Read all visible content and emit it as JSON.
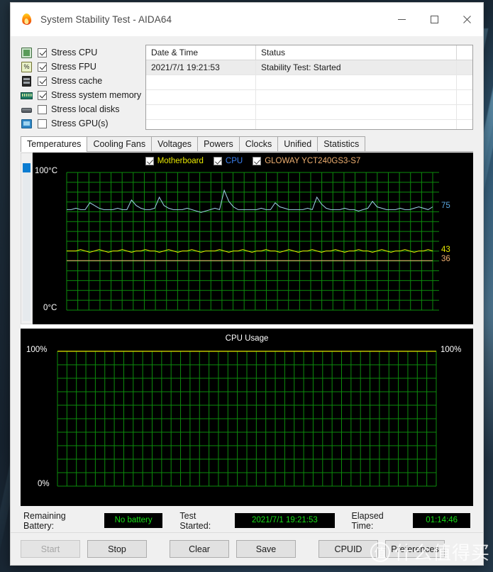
{
  "window": {
    "title": "System Stability Test - AIDA64",
    "icon": "flame-icon",
    "minimize": "─",
    "maximize": "□",
    "close": "✕"
  },
  "stress_options": [
    {
      "icon": "cpu-chip-icon",
      "label": "Stress CPU",
      "checked": true
    },
    {
      "icon": "fpu-chip-icon",
      "label": "Stress FPU",
      "checked": true
    },
    {
      "icon": "cache-chip-icon",
      "label": "Stress cache",
      "checked": true
    },
    {
      "icon": "memory-ram-icon",
      "label": "Stress system memory",
      "checked": true
    },
    {
      "icon": "hard-disk-icon",
      "label": "Stress local disks",
      "checked": false
    },
    {
      "icon": "gpu-card-icon",
      "label": "Stress GPU(s)",
      "checked": false
    }
  ],
  "status_grid": {
    "columns": [
      "Date & Time",
      "Status"
    ],
    "rows": [
      {
        "datetime": "2021/7/1 19:21:53",
        "status": "Stability Test: Started",
        "selected": true
      },
      {
        "datetime": "",
        "status": "",
        "selected": false
      },
      {
        "datetime": "",
        "status": "",
        "selected": false
      },
      {
        "datetime": "",
        "status": "",
        "selected": false
      },
      {
        "datetime": "",
        "status": "",
        "selected": false
      }
    ]
  },
  "tabs": [
    {
      "label": "Temperatures",
      "active": true
    },
    {
      "label": "Cooling Fans",
      "active": false
    },
    {
      "label": "Voltages",
      "active": false
    },
    {
      "label": "Powers",
      "active": false
    },
    {
      "label": "Clocks",
      "active": false
    },
    {
      "label": "Unified",
      "active": false
    },
    {
      "label": "Statistics",
      "active": false
    }
  ],
  "chart_data": [
    {
      "type": "line",
      "title": "",
      "xlabel": "",
      "ylabel": "Temperature",
      "ylim": [
        0,
        100
      ],
      "y_top_label": "100°C",
      "y_bottom_label": "0°C",
      "grid": true,
      "legend_position": "top-center",
      "background": "#000000",
      "grid_color": "#0c8c0c",
      "series": [
        {
          "name": "Motherboard",
          "color": "#e8e800",
          "checked": true,
          "current_value": 43,
          "unit": "°C",
          "values": [
            43,
            43,
            43,
            44,
            43,
            42,
            43,
            44,
            43,
            42,
            43,
            43,
            44,
            43,
            42,
            43,
            43,
            44,
            43,
            43,
            42,
            43,
            44,
            43,
            42,
            43,
            43,
            44,
            43,
            42,
            43,
            43,
            43,
            44,
            43,
            42,
            43,
            43,
            44,
            43,
            42,
            43,
            43,
            44,
            43,
            43,
            42,
            43,
            44,
            43,
            42,
            43,
            43,
            44,
            43,
            42,
            43,
            43,
            44,
            43,
            42,
            43,
            43,
            44,
            43,
            43,
            42,
            43,
            44,
            43,
            42,
            43,
            43,
            44,
            43,
            42,
            43,
            43,
            44,
            43
          ]
        },
        {
          "name": "CPU",
          "color": "#9fd4e8",
          "checked": true,
          "current_value": 75,
          "unit": "°C",
          "values": [
            73,
            73,
            74,
            73,
            73,
            78,
            76,
            74,
            73,
            73,
            73,
            74,
            73,
            73,
            80,
            76,
            74,
            73,
            73,
            74,
            82,
            76,
            74,
            73,
            73,
            73,
            74,
            73,
            72,
            71,
            72,
            73,
            74,
            73,
            87,
            79,
            75,
            73,
            73,
            73,
            73,
            73,
            74,
            73,
            73,
            78,
            75,
            74,
            73,
            73,
            73,
            73,
            74,
            73,
            82,
            77,
            74,
            73,
            73,
            73,
            74,
            73,
            73,
            72,
            73,
            74,
            79,
            75,
            74,
            73,
            73,
            73,
            74,
            73,
            73,
            74,
            75,
            74,
            73,
            75
          ]
        },
        {
          "name": "GLOWAY YCT240GS3-S7",
          "color": "#f0b070",
          "checked": true,
          "current_value": 36,
          "unit": "°C",
          "values": [
            36,
            36,
            36,
            36,
            36,
            36,
            36,
            36,
            36,
            36,
            36,
            36,
            36,
            36,
            36,
            36,
            36,
            36,
            36,
            36,
            36,
            36,
            36,
            36,
            36,
            36,
            36,
            36,
            36,
            36,
            36,
            36,
            36,
            36,
            36,
            36,
            36,
            36,
            36,
            36,
            36,
            36,
            36,
            36,
            36,
            36,
            36,
            36,
            36,
            36,
            36,
            36,
            36,
            36,
            36,
            36,
            36,
            36,
            36,
            36,
            36,
            36,
            36,
            36,
            36,
            36,
            36,
            36,
            36,
            36,
            36,
            36,
            36,
            36,
            36,
            36,
            36,
            36,
            36,
            36
          ]
        }
      ],
      "right_value_labels": [
        {
          "text": "75",
          "color": "#5aa8e0",
          "value": 75
        },
        {
          "text": "43",
          "color": "#e8e800",
          "value": 43
        },
        {
          "text": "36",
          "color": "#f0b070",
          "value": 36
        }
      ]
    },
    {
      "type": "line",
      "title": "CPU Usage",
      "xlabel": "",
      "ylabel": "CPU Usage",
      "ylim": [
        0,
        100
      ],
      "y_top_label_left": "100%",
      "y_bottom_label_left": "0%",
      "y_top_label_right": "100%",
      "grid": true,
      "legend_position": "none",
      "background": "#000000",
      "grid_color": "#0c8c0c",
      "series": [
        {
          "name": "CPU Usage",
          "color": "#e8e800",
          "current_value": 100,
          "unit": "%",
          "values": [
            100,
            100,
            100,
            100,
            100,
            100,
            100,
            100,
            100,
            100,
            100,
            100,
            100,
            100,
            100,
            100,
            100,
            100,
            100,
            100,
            100,
            100,
            100,
            100,
            100,
            100,
            100,
            100,
            100,
            100,
            100,
            100,
            100,
            100,
            100,
            100,
            100,
            100,
            100,
            100,
            100,
            100,
            100,
            100,
            100,
            100,
            100,
            100,
            100,
            100,
            100,
            100,
            100,
            100,
            100,
            100,
            100,
            100,
            100,
            100,
            100,
            100,
            100,
            100,
            100,
            100,
            100,
            100,
            100,
            100,
            100,
            100,
            100,
            100,
            100,
            100,
            100,
            100,
            100,
            100
          ]
        }
      ]
    }
  ],
  "status_strip": {
    "battery_label": "Remaining Battery:",
    "battery_value": "No battery",
    "started_label": "Test Started:",
    "started_value": "2021/7/1 19:21:53",
    "elapsed_label": "Elapsed Time:",
    "elapsed_value": "01:14:46",
    "value_color": "#16e016"
  },
  "buttons": [
    {
      "label": "Start",
      "disabled": true
    },
    {
      "label": "Stop",
      "disabled": false
    },
    {
      "label": "Clear",
      "disabled": false
    },
    {
      "label": "Save",
      "disabled": false
    },
    {
      "label": "CPUID",
      "disabled": false
    },
    {
      "label": "Preferences",
      "disabled": false
    }
  ],
  "watermark": {
    "badge": "值",
    "text": "什么值得买"
  }
}
